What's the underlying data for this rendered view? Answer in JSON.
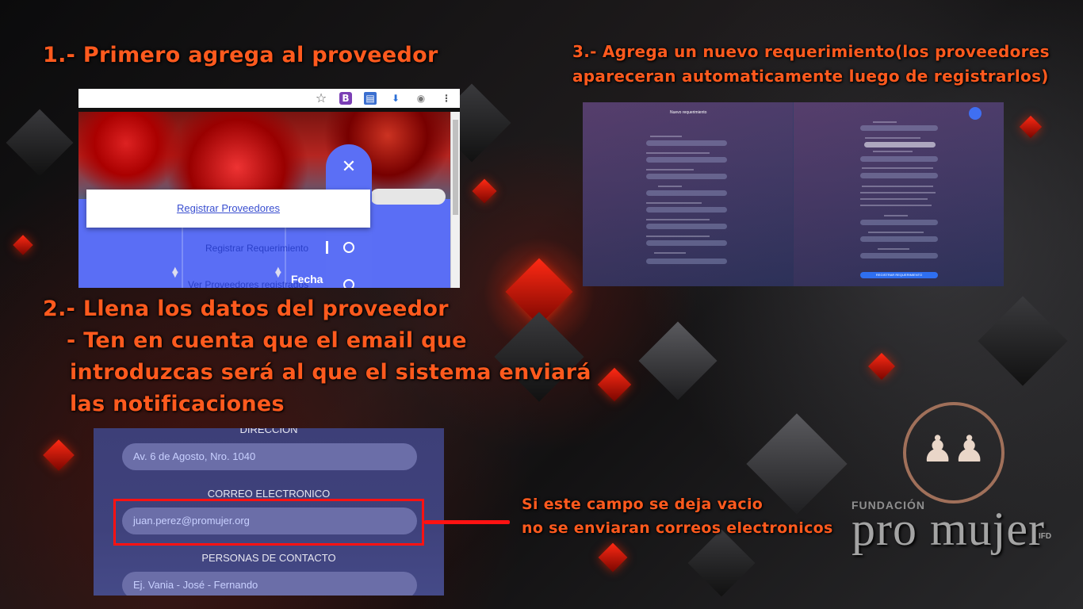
{
  "steps": {
    "step1": "1.- Primero agrega al proveedor",
    "step2": "2.- Llena los datos del proveedor",
    "step2_line1": "- Ten en cuenta que el email que",
    "step2_line2": "introduzcas será al que el sistema enviará",
    "step2_line3": "las notificaciones",
    "step3_line1": "3.- Agrega un nuevo requerimiento(los proveedores",
    "step3_line2": "apareceran automaticamente luego de registrarlos)"
  },
  "note": {
    "line1": "Si este campo se deja vacio",
    "line2": "no se enviaran correos electronicos"
  },
  "screenshot1": {
    "popup_link": "Registrar Proveedores",
    "menu_item_requirement": "Registrar Requerimiento",
    "menu_item_view": "Ver Proveedores registrados",
    "column_header": "Fecha",
    "close_glyph": "✕",
    "star_glyph": "☆",
    "ext_b": "B",
    "menu_glyph": "⋮",
    "toolbar_icons": [
      "star-icon",
      "bootstrap-extension-icon",
      "contact-card-icon",
      "download-icon",
      "globe-icon",
      "menu-icon"
    ]
  },
  "screenshot3": {
    "header": "Nuevo requerimiento",
    "submit": "REGISTRAR REQUERIMIENTO"
  },
  "form": {
    "address_label": "DIRECCION",
    "address_value": "Av. 6 de Agosto, Nro. 1040",
    "email_label": "CORREO ELECTRONICO",
    "email_value": "juan.perez@promujer.org",
    "contacts_label": "PERSONAS DE CONTACTO",
    "contacts_placeholder": "Ej. Vania - José - Fernando"
  },
  "logo": {
    "org_small": "FUNDACIÓN",
    "org_name": "pro mujer",
    "suffix": "IFD"
  },
  "colors": {
    "heading": "#ff5a1e",
    "highlight": "#ff1212",
    "app_primary": "#5a6ef5"
  }
}
